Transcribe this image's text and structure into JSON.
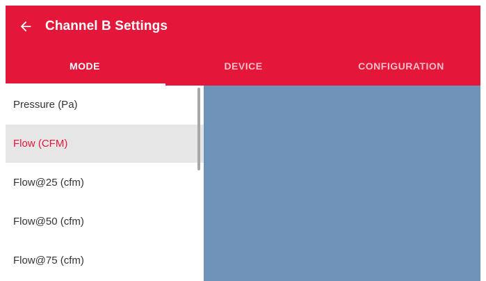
{
  "header": {
    "title": "Channel B Settings",
    "back_icon": "arrow-left-icon"
  },
  "tabs": [
    {
      "label": "MODE",
      "active": true
    },
    {
      "label": "DEVICE",
      "active": false
    },
    {
      "label": "CONFIGURATION",
      "active": false
    }
  ],
  "mode_list": {
    "items": [
      {
        "label": "Pressure (Pa)",
        "selected": false
      },
      {
        "label": "Flow (CFM)",
        "selected": true
      },
      {
        "label": "Flow@25 (cfm)",
        "selected": false
      },
      {
        "label": "Flow@50 (cfm)",
        "selected": false
      },
      {
        "label": "Flow@75 (cfm)",
        "selected": false
      }
    ]
  },
  "colors": {
    "accent": "#e4163a",
    "selected_background": "#e6e6e6",
    "panel_background": "#6f93b8"
  }
}
